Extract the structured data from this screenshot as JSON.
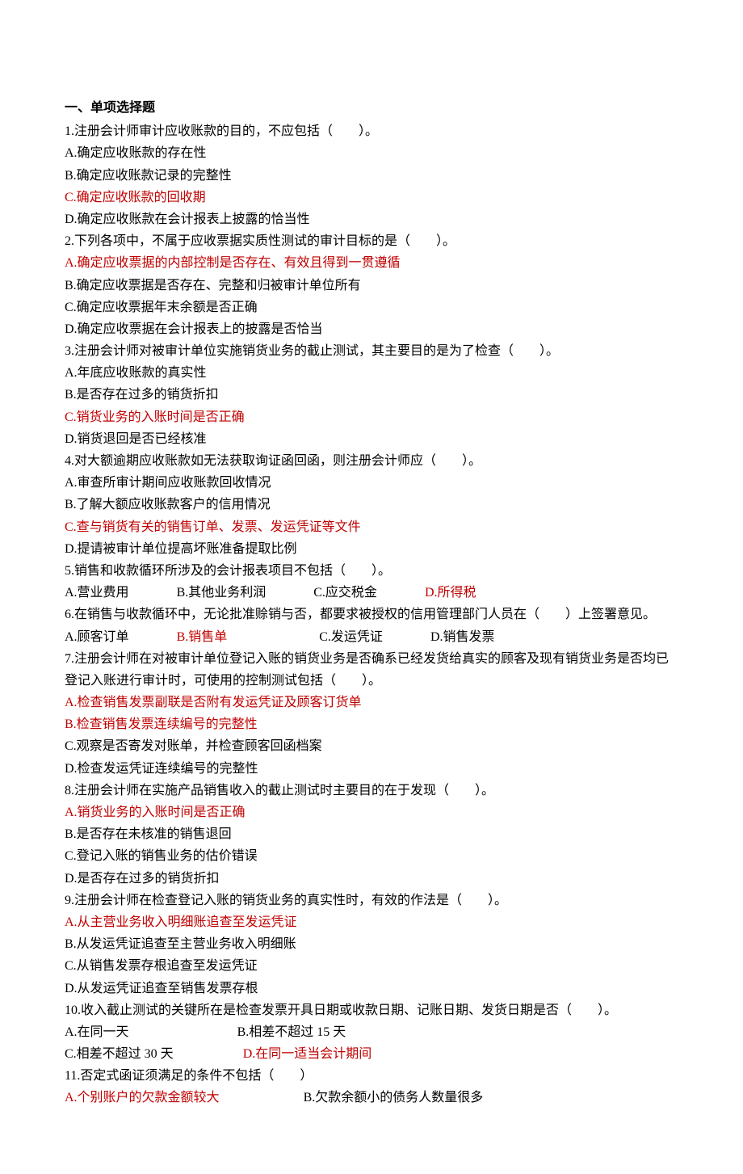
{
  "section_title": "一、单项选择题",
  "q1": {
    "stem": "1.注册会计师审计应收账款的目的，不应包括（　　）。",
    "a": "A.确定应收账款的存在性",
    "b": "B.确定应收账款记录的完整性",
    "c": "C.确定应收账款的回收期",
    "d": "D.确定应收账款在会计报表上披露的恰当性"
  },
  "q2": {
    "stem": "2.下列各项中，不属于应收票据实质性测试的审计目标的是（　　）。",
    "a": "A.确定应收票据的内部控制是否存在、有效且得到一贯遵循",
    "b": "B.确定应收票据是否存在、完整和归被审计单位所有",
    "c": "C.确定应收票据年末余额是否正确",
    "d": "D.确定应收票据在会计报表上的披露是否恰当"
  },
  "q3": {
    "stem": "3.注册会计师对被审计单位实施销货业务的截止测试，其主要目的是为了检查（　　）。",
    "a": "A.年底应收账款的真实性",
    "b": "B.是否存在过多的销货折扣",
    "c": "C.销货业务的入账时间是否正确",
    "d": "D.销货退回是否已经核准"
  },
  "q4": {
    "stem": "4.对大额逾期应收账款如无法获取询证函回函，则注册会计师应（　　）。",
    "a": "A.审查所审计期间应收账款回收情况",
    "b": "B.了解大额应收账款客户的信用情况",
    "c": "C.查与销货有关的销售订单、发票、发运凭证等文件",
    "d": "D.提请被审计单位提高坏账准备提取比例"
  },
  "q5": {
    "stem": "5.销售和收款循环所涉及的会计报表项目不包括（　　）。",
    "a": "A.营业费用",
    "b": "B.其他业务利润",
    "c": "C.应交税金",
    "d": "D.所得税"
  },
  "q6": {
    "stem": "6.在销售与收款循环中，无论批准赊销与否，都要求被授权的信用管理部门人员在（　　）上签署意见。",
    "a": "A.顾客订单",
    "b": "B.销售单",
    "c": "C.发运凭证",
    "d": "D.销售发票"
  },
  "q7": {
    "stem1": "7.注册会计师在对被审计单位登记入账的销货业务是否确系已经发货给真实的顾客及现有销货业务是否均已",
    "stem2": "登记入账进行审计时，可使用的控制测试包括（　　）。",
    "a": "A.检查销售发票副联是否附有发运凭证及顾客订货单",
    "b": "B.检查销售发票连续编号的完整性",
    "c": "C.观察是否寄发对账单，并检查顾客回函档案",
    "d": "D.检查发运凭证连续编号的完整性"
  },
  "q8": {
    "stem": "8.注册会计师在实施产品销售收入的截止测试时主要目的在于发现（　　）。",
    "a": "A.销货业务的入账时间是否正确",
    "b": "B.是否存在未核准的销售退回",
    "c": "C.登记入账的销售业务的估价错误",
    "d": "D.是否存在过多的销货折扣"
  },
  "q9": {
    "stem": "9.注册会计师在检查登记入账的销货业务的真实性时，有效的作法是（　　）。",
    "a": "A.从主营业务收入明细账追查至发运凭证",
    "b": "B.从发运凭证追查至主营业务收入明细账",
    "c": "C.从销售发票存根追查至发运凭证",
    "d": "D.从发运凭证追查至销售发票存根"
  },
  "q10": {
    "stem": "10.收入截止测试的关键所在是检查发票开具日期或收款日期、记账日期、发货日期是否（　　）。",
    "a": "A.在同一天",
    "b": "B.相差不超过 15 天",
    "c": "C.相差不超过 30 天",
    "d": "D.在同一适当会计期间"
  },
  "q11": {
    "stem": "11.否定式函证须满足的条件不包括（　　）",
    "a": "A.个别账户的欠款金额较大",
    "b": "B.欠款余额小的债务人数量很多"
  }
}
